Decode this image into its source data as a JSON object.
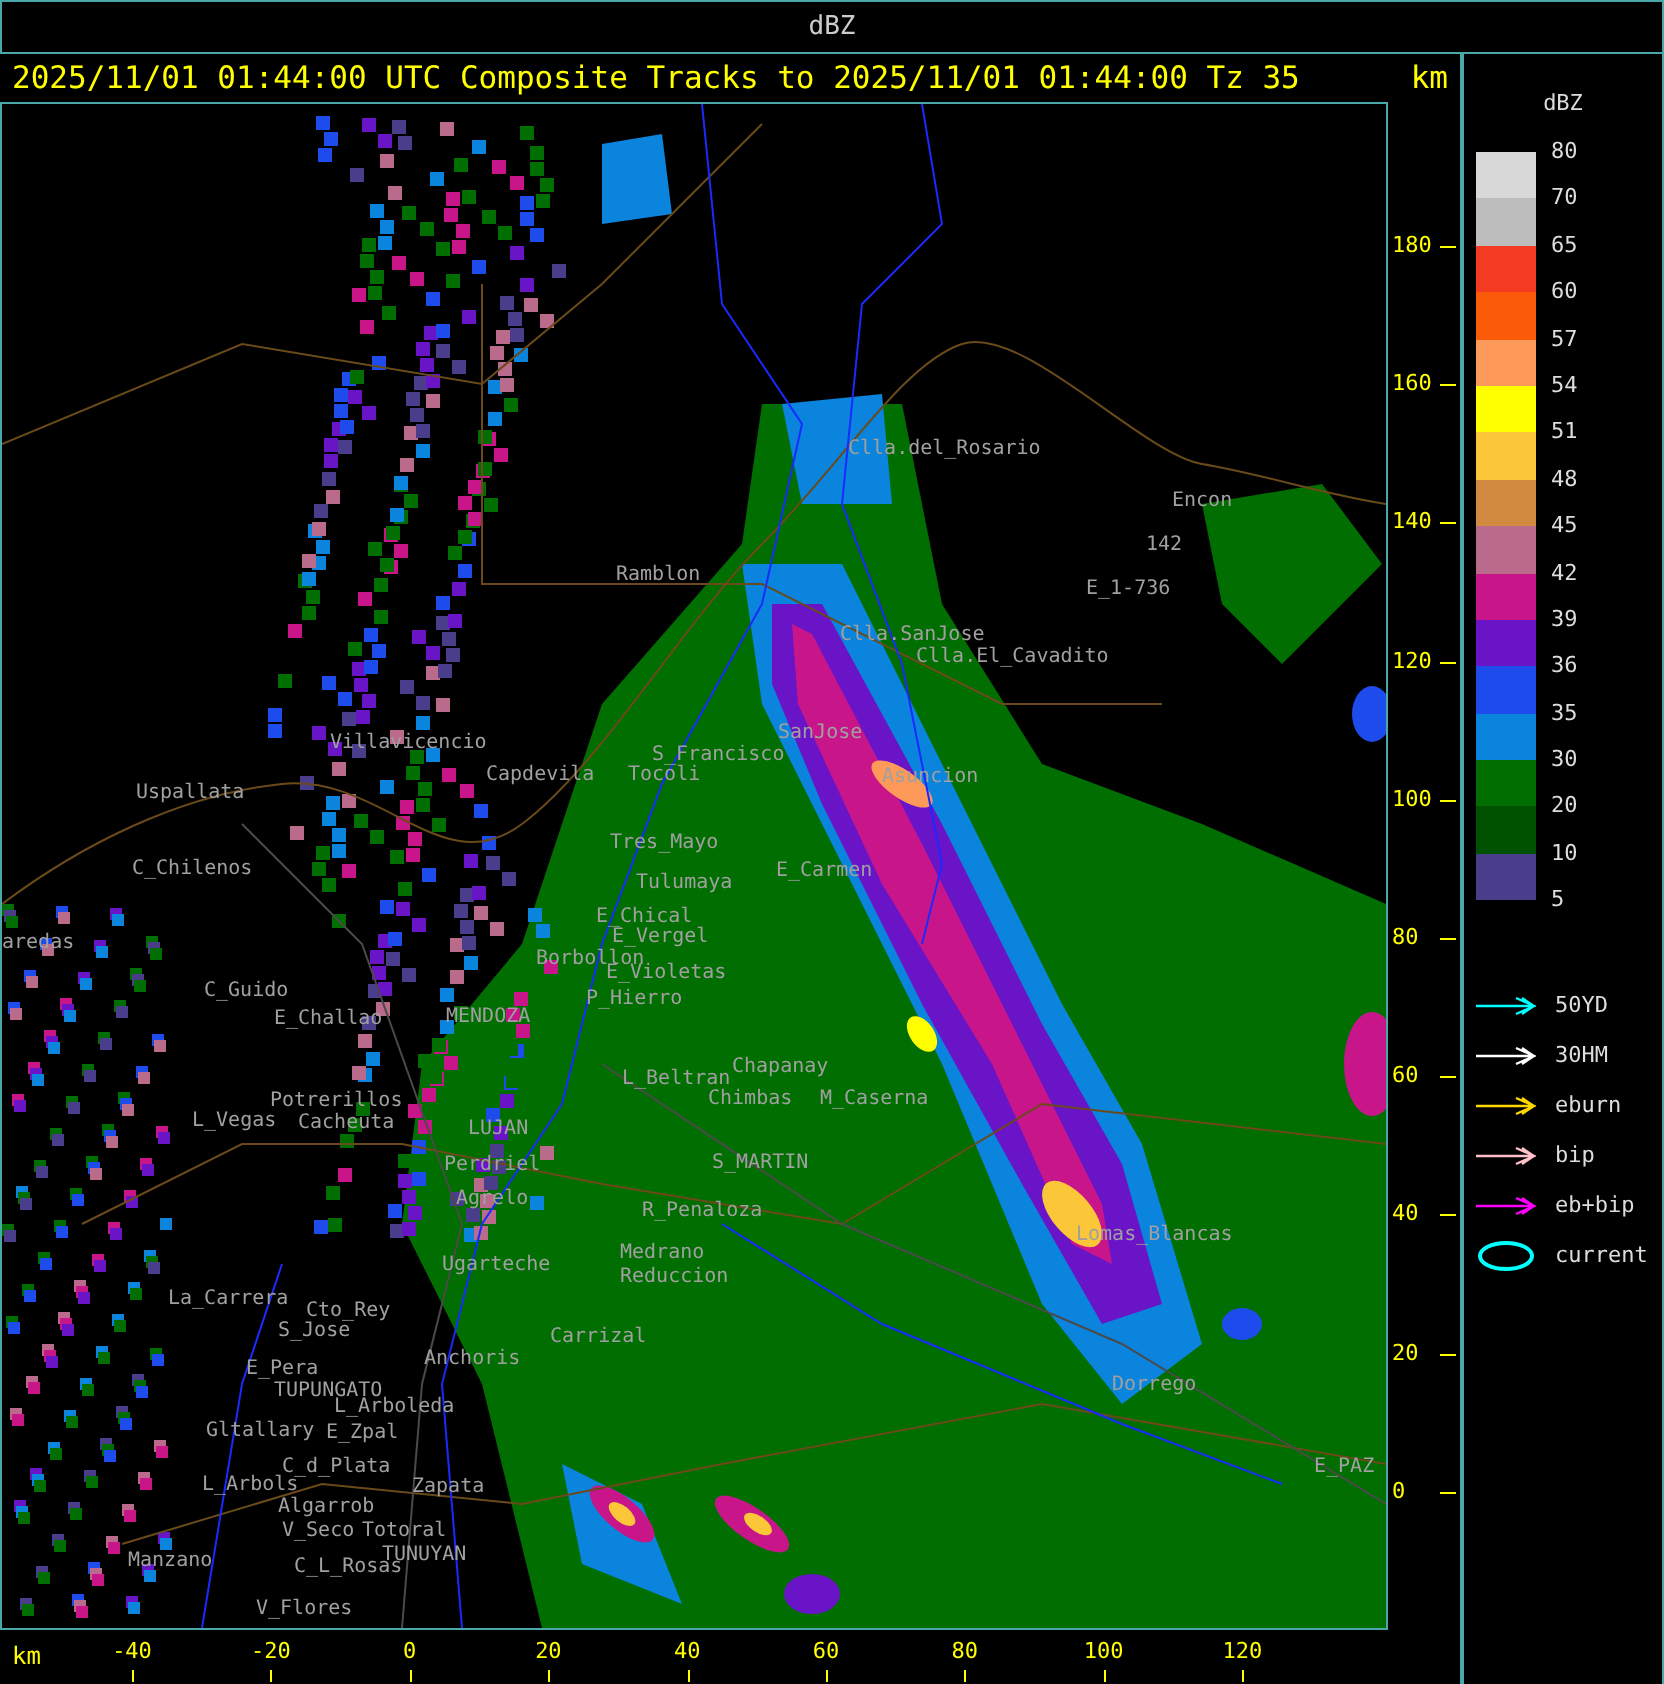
{
  "top_bar": {
    "title": "dBZ"
  },
  "header": {
    "title": "2025/11/01 01:44:00 UTC Composite Tracks to 2025/11/01 01:44:00 Tz 35",
    "unit": "km"
  },
  "map": {
    "places": [
      "Clla.del_Rosario",
      "Encon",
      "142",
      "E_1-736",
      "Ramblon",
      "Clla.SanJose",
      "Clla.El_Cavadito",
      "SanJose",
      "S_Francisco",
      "Tocoli",
      "Asuncion",
      "Villavicencio",
      "Capdevila",
      "Uspallata",
      "Tres_Mayo",
      "C_Chilenos",
      "E_Carmen",
      "Tulumaya",
      "E_Chical",
      "E_Vergel",
      "aredas",
      "Borbollon",
      "E_Violetas",
      "C_Guido",
      "P_Hierro",
      "E_Challao",
      "MENDOZA",
      "Chapanay",
      "L_Beltran",
      "Potrerillos",
      "Chimbas",
      "M_Caserna",
      "L_Vegas",
      "Cacheuta",
      "LUJAN",
      "S_MARTIN",
      "Perdriel",
      "Agrelo",
      "R_Penaloza",
      "Medrano",
      "Reduccion",
      "Lomas_Blancas",
      "Ugarteche",
      "La_Carrera",
      "Cto_Rey",
      "S_Jose",
      "Carrizal",
      "Anchoris",
      "E_Pera",
      "TUPUNGATO",
      "L_Arboleda",
      "Gltallary",
      "E_Zpal",
      "C_d_Plata",
      "L_Arbols",
      "Zapata",
      "Algarrob",
      "V_Seco",
      "Totoral",
      "TUNUYAN",
      "Manzano",
      "C_L_Rosas",
      "V_Flores",
      "Dorrego",
      "E_PAZ"
    ]
  },
  "y_axis": {
    "ticks": [
      "180",
      "160",
      "140",
      "120",
      "100",
      "80",
      "60",
      "40",
      "20",
      "0"
    ]
  },
  "x_axis": {
    "unit": "km",
    "ticks": [
      "-40",
      "-20",
      "0",
      "20",
      "40",
      "60",
      "80",
      "100",
      "120"
    ]
  },
  "legend": {
    "title": "dBZ",
    "labels": [
      "80",
      "70",
      "65",
      "60",
      "57",
      "54",
      "51",
      "48",
      "45",
      "42",
      "39",
      "36",
      "35",
      "30",
      "20",
      "10",
      "5"
    ],
    "bins": [
      {
        "color": "#d8d8d8"
      },
      {
        "color": "#bdbdbd"
      },
      {
        "color": "#f53a22"
      },
      {
        "color": "#fb5b08"
      },
      {
        "color": "#fd9a5a"
      },
      {
        "color": "#ffff00"
      },
      {
        "color": "#fbc638"
      },
      {
        "color": "#d18a40"
      },
      {
        "color": "#ba6a8a"
      },
      {
        "color": "#c8168a"
      },
      {
        "color": "#6a14c8"
      },
      {
        "color": "#1e4cec"
      },
      {
        "color": "#0a84dc"
      },
      {
        "color": "#006e00"
      },
      {
        "color": "#005200"
      },
      {
        "color": "#4a3e8c"
      }
    ],
    "tracks": [
      {
        "kind": "arrow",
        "color": "#00ffff",
        "label": "50YD"
      },
      {
        "kind": "arrow",
        "color": "#ffffff",
        "label": "30HM"
      },
      {
        "kind": "arrow",
        "color": "#ffd700",
        "label": "eburn"
      },
      {
        "kind": "arrow",
        "color": "#ffc0cb",
        "label": "bip"
      },
      {
        "kind": "arrow",
        "color": "#ff00ff",
        "label": "eb+bip"
      },
      {
        "kind": "ellipse",
        "color": "#00ffff",
        "label": "current"
      }
    ]
  }
}
